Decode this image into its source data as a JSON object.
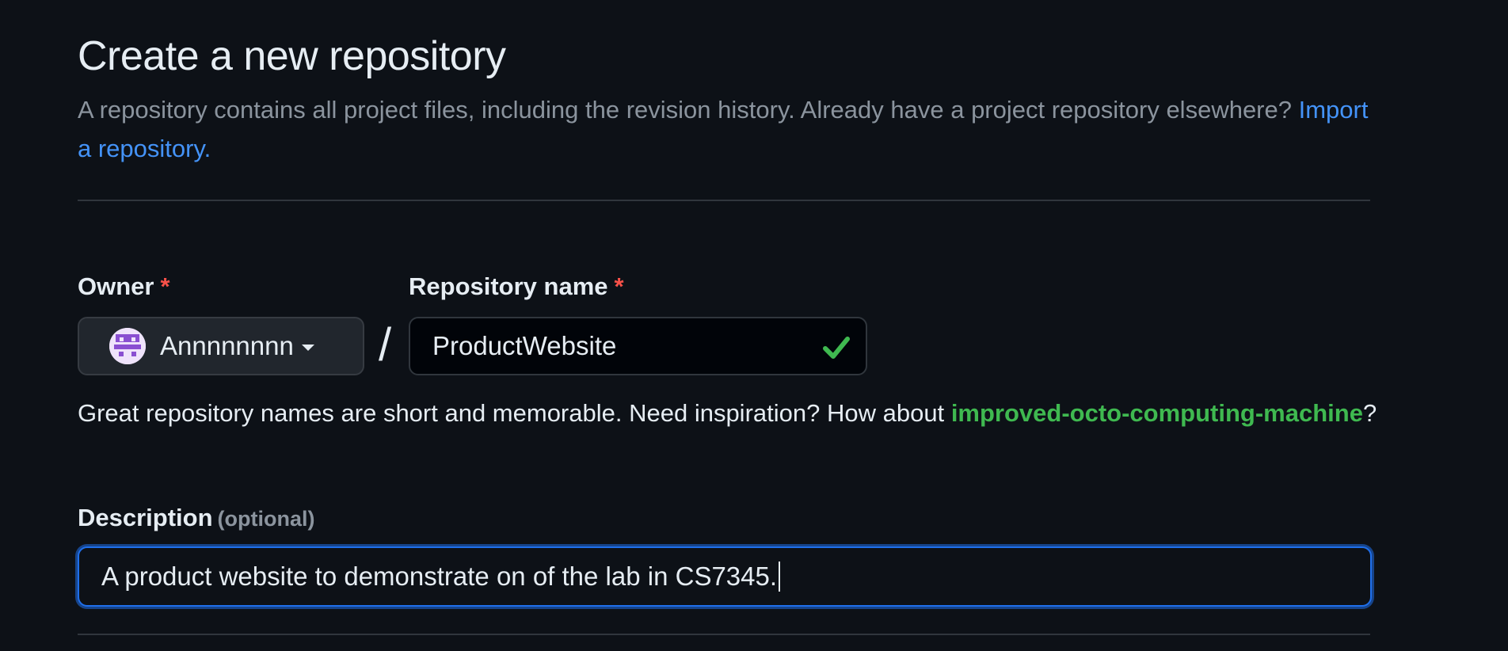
{
  "header": {
    "title": "Create a new repository",
    "subtitle": "A repository contains all project files, including the revision history. Already have a project repository elsewhere?",
    "import_link": "Import a repository."
  },
  "owner": {
    "label": "Owner",
    "required_mark": "*",
    "value": "Annnnnnnn",
    "avatar_icon": "identicon-avatar"
  },
  "separator": "/",
  "repo_name": {
    "label": "Repository name",
    "required_mark": "*",
    "value": "ProductWebsite",
    "valid_icon": "check-icon"
  },
  "hint": {
    "text": "Great repository names are short and memorable. Need inspiration? How about",
    "suggestion": "improved-octo-computing-machine",
    "end": "?"
  },
  "description": {
    "label": "Description",
    "optional_label": "(optional)",
    "value": "A product website to demonstrate on of the lab in CS7345."
  },
  "colors": {
    "background": "#0d1117",
    "accent_link": "#4493f8",
    "success": "#3fb950",
    "required": "#f85149",
    "focus": "#1f6feb"
  }
}
